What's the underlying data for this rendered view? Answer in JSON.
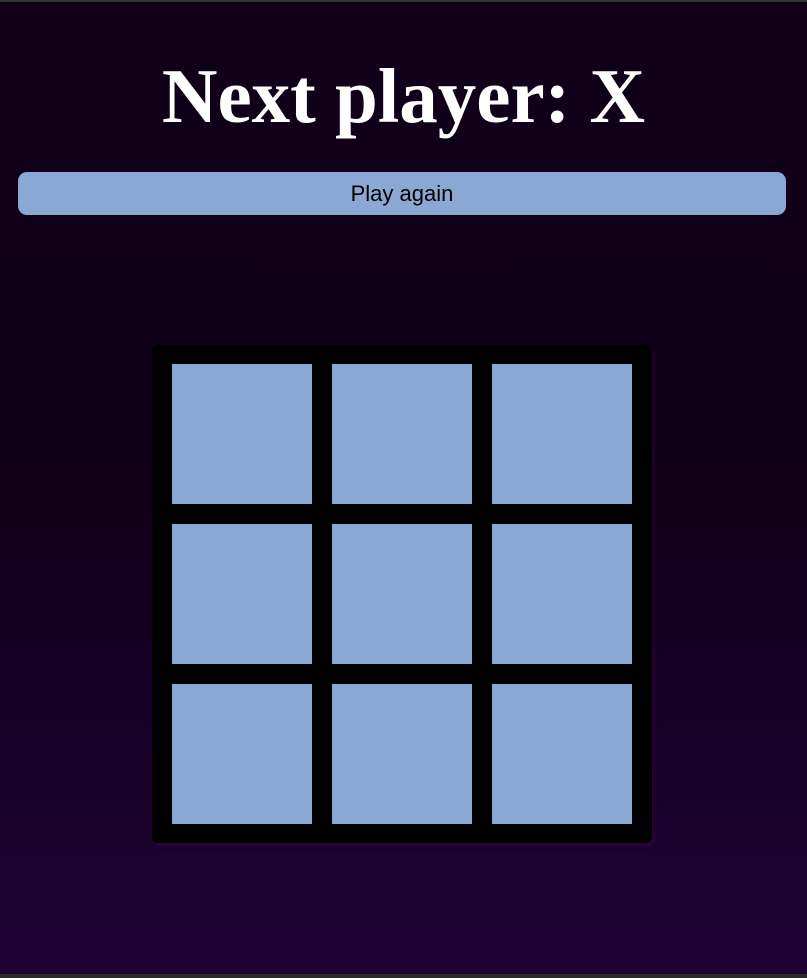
{
  "game": {
    "status_text": "Next player: X",
    "play_again_label": "Play again",
    "board": [
      "",
      "",
      "",
      "",
      "",
      "",
      "",
      "",
      ""
    ]
  },
  "colors": {
    "background_top": "#10001a",
    "background_bottom": "#210233",
    "cell": "#8ba7d4",
    "board_frame": "#000000",
    "button": "#8ba7d4",
    "status_text": "#ffffff"
  }
}
